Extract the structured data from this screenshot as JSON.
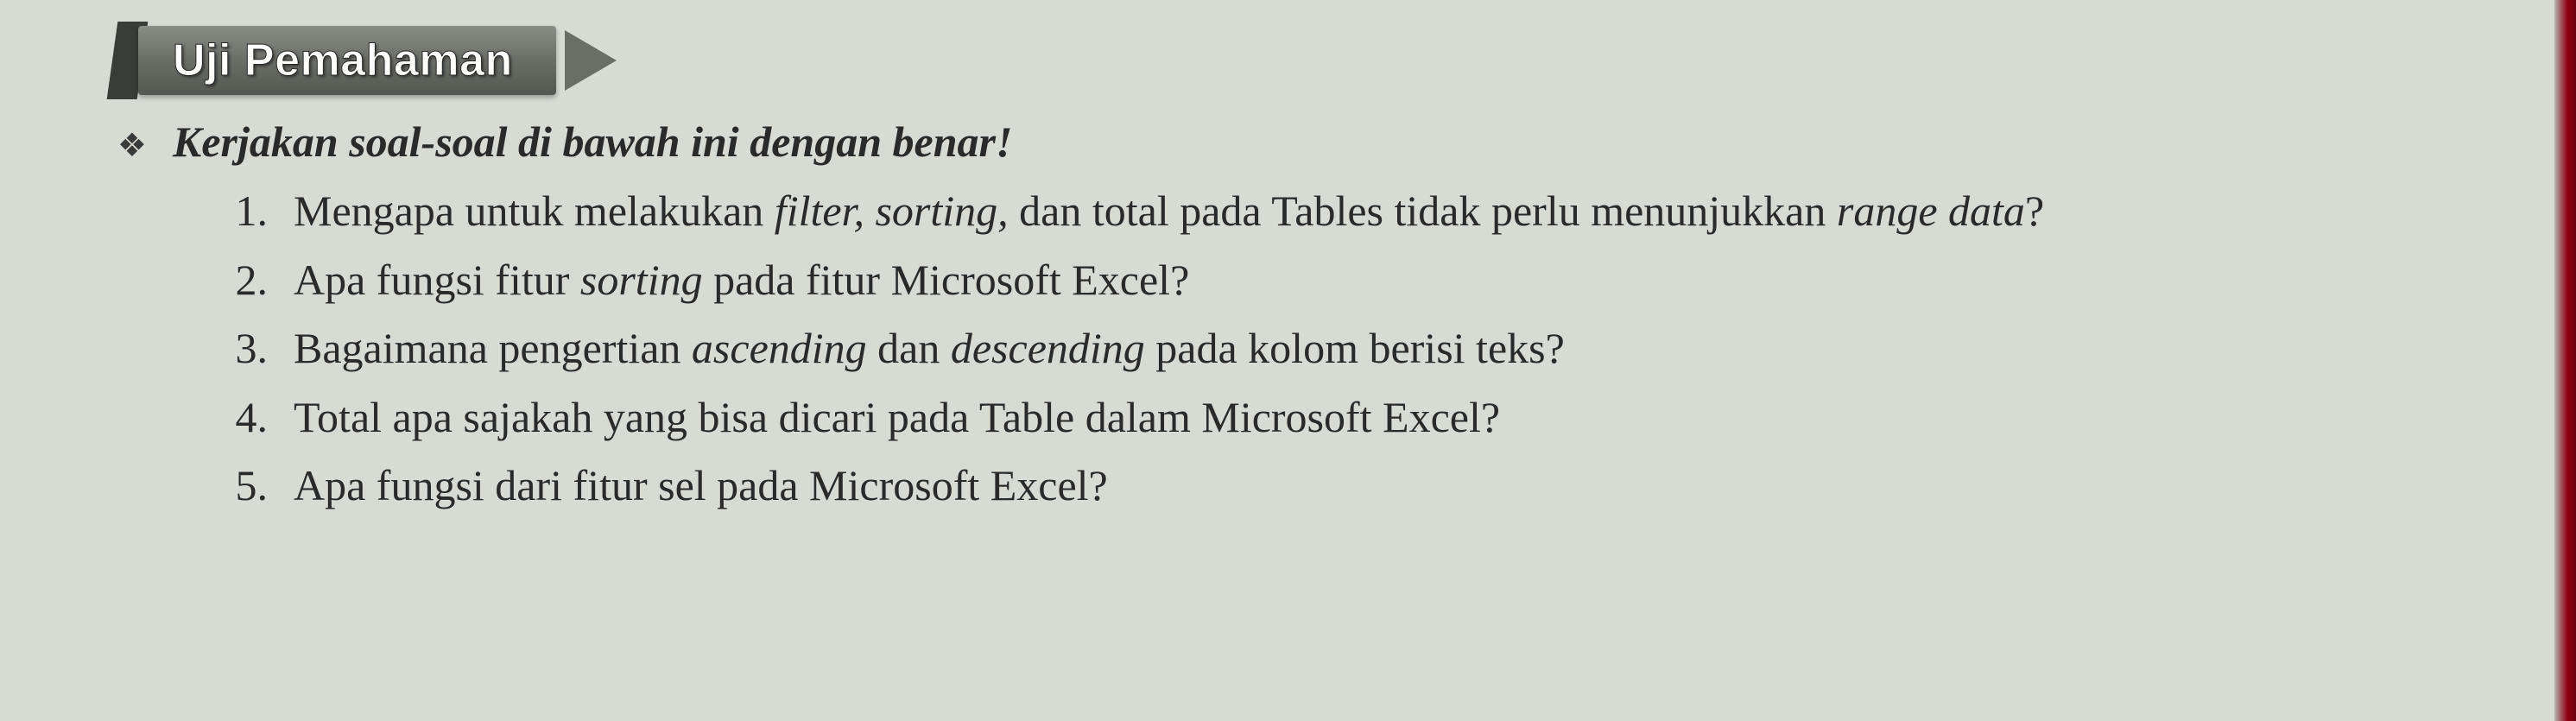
{
  "banner": {
    "title": "Uji Pemahaman"
  },
  "instruction": {
    "bullet": "❖",
    "text": "Kerjakan soal-soal di bawah ini dengan benar!"
  },
  "questions": [
    {
      "number": "1.",
      "html": "Mengapa untuk melakukan <em>filter, sorting,</em> dan total pada Tables tidak perlu menunjukkan <em>range data</em>?"
    },
    {
      "number": "2.",
      "html": "Apa fungsi fitur <em>sorting</em> pada fitur Microsoft Excel?"
    },
    {
      "number": "3.",
      "html": "Bagaimana pengertian <em>ascending</em> dan <em>descending</em> pada kolom berisi teks?"
    },
    {
      "number": "4.",
      "html": "Total apa sajakah yang bisa dicari pada Table dalam Microsoft Excel?"
    },
    {
      "number": "5.",
      "html": "Apa fungsi dari fitur sel pada Microsoft Excel?"
    }
  ]
}
